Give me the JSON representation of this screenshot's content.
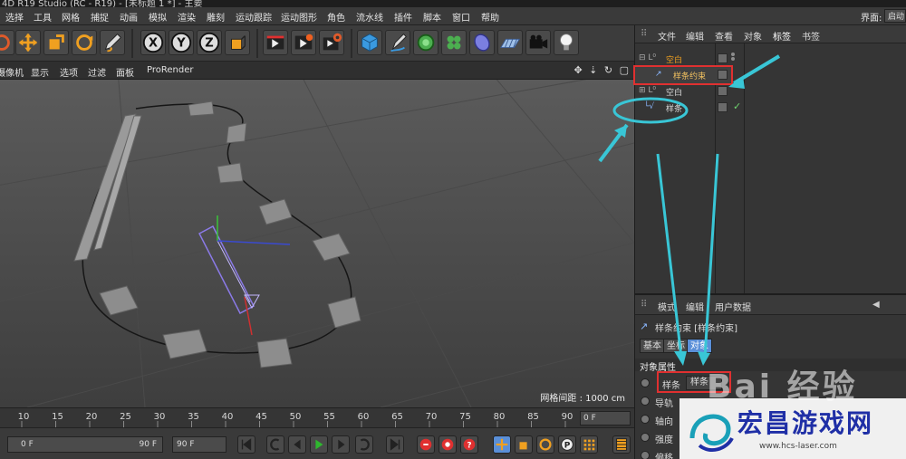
{
  "app": {
    "title": "4D R19 Studio (RC - R19) - [未标题 1 *] - 主要"
  },
  "menubar": {
    "items": [
      "选择",
      "工具",
      "网格",
      "捕捉",
      "动画",
      "模拟",
      "渲染",
      "雕刻",
      "运动跟踪",
      "运动图形",
      "角色",
      "流水线",
      "插件",
      "脚本",
      "窗口",
      "帮助"
    ],
    "layout_label": "界面:",
    "layout_value": "启动"
  },
  "toolbar": {
    "icons": [
      "rotate-icon",
      "move-icon",
      "scale-icon",
      "rotate-tool-icon",
      "live-select-icon",
      "x-axis-icon",
      "y-axis-icon",
      "z-axis-icon",
      "coordinate-system-icon",
      "render-view-icon",
      "render-picture-icon",
      "render-settings-icon",
      "cube-icon",
      "pen-icon",
      "subdivision-icon",
      "cloner-icon",
      "deformer-icon",
      "floor-icon",
      "camera-icon",
      "light-icon"
    ],
    "x_label": "X",
    "y_label": "Y",
    "z_label": "Z"
  },
  "viewport": {
    "menu": [
      "摄像机",
      "显示",
      "选项",
      "过滤",
      "面板",
      "ProRender"
    ],
    "grid_spacing": "网格间距 : 1000 cm",
    "nav_icons": [
      "move-view-icon",
      "zoom-view-icon",
      "rotate-view-icon",
      "maximize-view-icon"
    ]
  },
  "timeline": {
    "ticks": [
      "10",
      "15",
      "20",
      "25",
      "30",
      "35",
      "40",
      "45",
      "50",
      "55",
      "60",
      "65",
      "70",
      "75",
      "80",
      "85",
      "90"
    ],
    "current_frame": "0 F"
  },
  "playback": {
    "start_field": "0 F",
    "end_field_inner": "90 F",
    "end_field": "90 F",
    "buttons": [
      "go-start-icon",
      "prev-key-icon",
      "play-back-icon",
      "play-icon",
      "next-key-icon",
      "go-end-icon",
      "go-last-icon",
      "record-icon",
      "autokey-icon",
      "help-icon",
      "move-key-icon",
      "scale-key-icon",
      "rotate-key-icon",
      "param-key-icon",
      "pla-key-icon",
      "timeline-icon"
    ]
  },
  "object_manager": {
    "menu": [
      "文件",
      "编辑",
      "查看",
      "对象",
      "标签",
      "书签"
    ],
    "objects": [
      {
        "name": "空白",
        "color": "#f0a020"
      },
      {
        "name": "样条约束",
        "color": "#f0c060"
      },
      {
        "name": "空白",
        "color": "#dcdcdc"
      },
      {
        "name": "样条",
        "color": "#dcdcdc"
      }
    ]
  },
  "attribute_manager": {
    "menu": [
      "模式",
      "编辑",
      "用户数据"
    ],
    "title": "样条约束 [样条约束]",
    "tabs": [
      "基本",
      "坐标",
      "对象"
    ],
    "section": "对象属性",
    "fields": [
      {
        "label": "样条",
        "value": "样条"
      },
      {
        "label": "导轨",
        "value": ""
      },
      {
        "label": "轴向",
        "value": ""
      },
      {
        "label": "强度",
        "value": ""
      },
      {
        "label": "偏移",
        "value": ""
      }
    ]
  },
  "watermark": {
    "title": "宏昌游戏网",
    "url": "www.hcs-laser.com",
    "baidu": "Bai 经验"
  },
  "colors": {
    "highlight_red": "#e03030",
    "annotation_cyan": "#39c6d6",
    "active_tab": "#5a8fd8"
  }
}
